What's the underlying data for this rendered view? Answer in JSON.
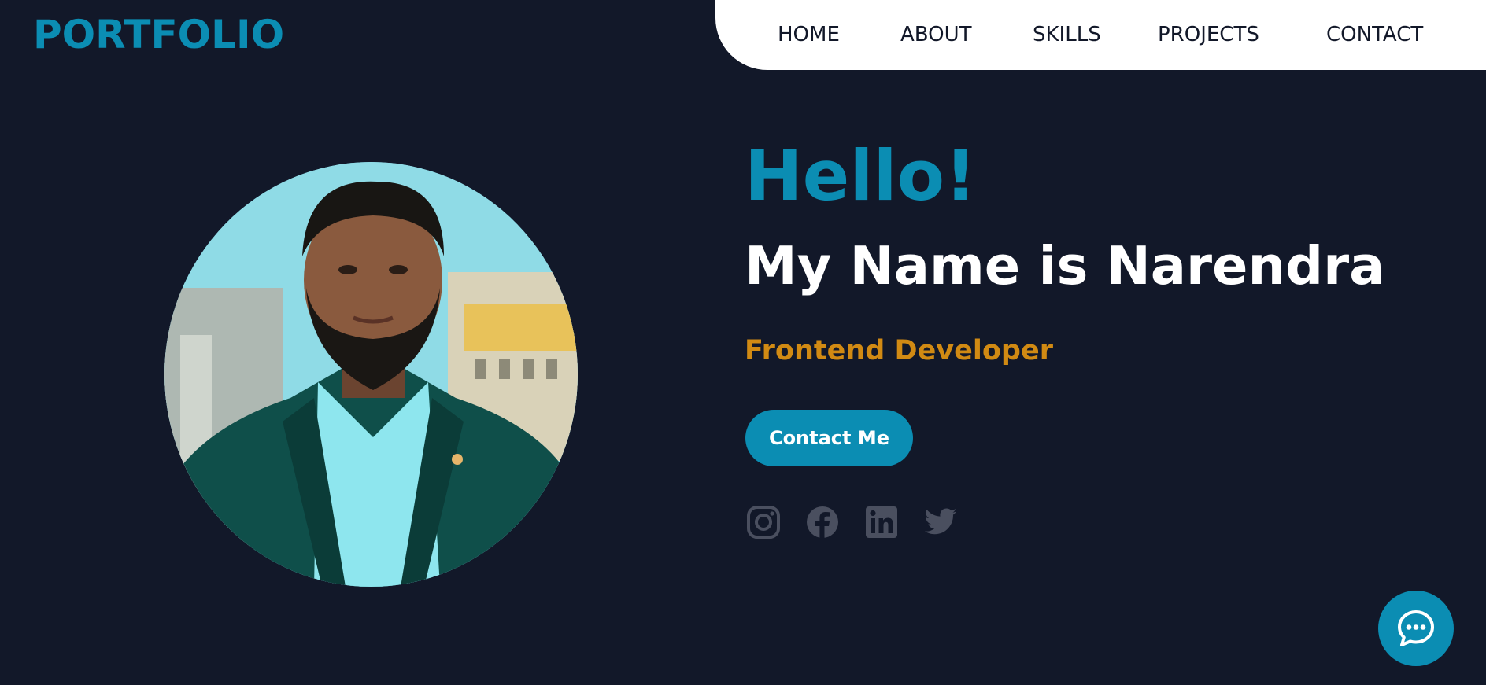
{
  "header": {
    "logo": "PORTFOLIO",
    "nav": [
      {
        "label": "HOME"
      },
      {
        "label": "ABOUT"
      },
      {
        "label": "SKILLS"
      },
      {
        "label": "PROJECTS"
      },
      {
        "label": "CONTACT"
      }
    ]
  },
  "hero": {
    "greeting": "Hello!",
    "name_line": "My Name is Narendra",
    "role": "Frontend Developer",
    "cta_label": "Contact Me",
    "social_icons": [
      "instagram-icon",
      "facebook-icon",
      "linkedin-icon",
      "twitter-icon"
    ]
  },
  "chat": {
    "icon": "chat-bubble-icon"
  },
  "colors": {
    "background": "#121829",
    "accent": "#0b8db3",
    "role_text": "#d18a13",
    "nav_background": "#ffffff",
    "social_icon": "#4a4f5f"
  }
}
